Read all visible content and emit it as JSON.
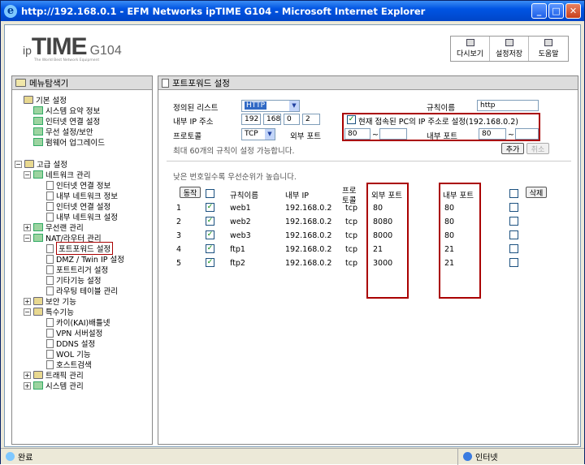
{
  "window": {
    "title": "http://192.168.0.1 - EFM Networks ipTIME G104 - Microsoft Internet Explorer"
  },
  "header": {
    "logo_ip": "ip",
    "logo_time": "TIME",
    "logo_model": "G104",
    "tagline": "The World Best Network Equipment",
    "buttons": [
      "다시보기",
      "설정저장",
      "도움말"
    ]
  },
  "sidebar": {
    "title": "메뉴탐색기",
    "basic": {
      "label": "기본 설정",
      "items": [
        "시스템 요약 정보",
        "인터넷 연결 설정",
        "무선 설정/보안",
        "펌웨어 업그레이드"
      ]
    },
    "advanced": {
      "label": "고급 설정",
      "network": {
        "label": "네트워크 관리",
        "items": [
          "인터넷 연결 정보",
          "내부 네트워크 정보",
          "인터넷 연결 설정",
          "내부 네트워크 설정"
        ]
      },
      "wireless": "무선랜 관리",
      "nat": {
        "label": "NAT/라우터 관리",
        "items": [
          "포트포워드 설정",
          "DMZ / Twin IP 설정",
          "포트트리거 설정",
          "기타기능 설정",
          "라우팅 테이블 관리"
        ]
      },
      "security": "보안 기능",
      "special": {
        "label": "특수기능",
        "items": [
          "카이(KAI)배틀넷",
          "VPN 서버설정",
          "DDNS 설정",
          "WOL 기능",
          "호스트검색"
        ]
      },
      "traffic": "트래픽 관리",
      "system": "시스템 관리"
    }
  },
  "main": {
    "title": "포트포워드 설정",
    "form": {
      "preset_label": "정의된 리스트",
      "preset_value": "HTTP",
      "rule_name_label": "규칙이름",
      "rule_name_value": "http",
      "ip_label": "내부 IP 주소",
      "ip": [
        "192",
        "168",
        "0",
        "2"
      ],
      "current_pc_label": "현재 접속된 PC의 IP 주소로 설정(192.168.0.2)",
      "protocol_label": "프로토콜",
      "protocol_value": "TCP",
      "ext_port_label": "외부 포트",
      "ext_port_from": "80",
      "ext_port_to": "",
      "int_port_label": "내부 포트",
      "int_port_from": "80",
      "int_port_to": "",
      "range_sep": "~",
      "max_note": "최대 60개의 규칙이 설정 가능합니다.",
      "add_button": "추가",
      "cancel_button": "취소"
    },
    "priority_note": "낮은 번호일수록 우선순위가 높습니다.",
    "table": {
      "headers": {
        "action": "동작",
        "name": "규칙이름",
        "ip": "내부 IP",
        "proto1": "프로",
        "proto2": "토콜",
        "ext": "외부 포트",
        "int": "내부 포트",
        "delete": "삭제"
      },
      "rows": [
        {
          "no": "1",
          "name": "web1",
          "ip": "192.168.0.2",
          "proto": "tcp",
          "ext": "80",
          "int": "80"
        },
        {
          "no": "2",
          "name": "web2",
          "ip": "192.168.0.2",
          "proto": "tcp",
          "ext": "8080",
          "int": "80"
        },
        {
          "no": "3",
          "name": "web3",
          "ip": "192.168.0.2",
          "proto": "tcp",
          "ext": "8000",
          "int": "80"
        },
        {
          "no": "4",
          "name": "ftp1",
          "ip": "192.168.0.2",
          "proto": "tcp",
          "ext": "21",
          "int": "21"
        },
        {
          "no": "5",
          "name": "ftp2",
          "ip": "192.168.0.2",
          "proto": "tcp",
          "ext": "3000",
          "int": "21"
        }
      ]
    }
  },
  "status": {
    "left": "완료",
    "zone": "인터넷"
  }
}
